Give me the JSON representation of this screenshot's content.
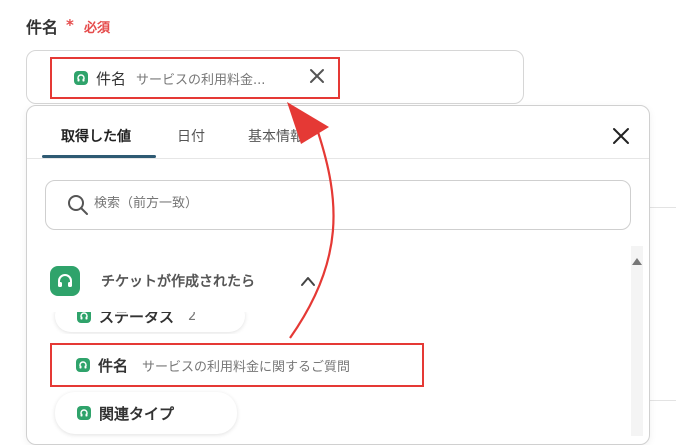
{
  "field": {
    "label": "件名",
    "required_star": "*",
    "required_text": "必須",
    "chip": {
      "title": "件名",
      "value": "サービスの利用料金..."
    }
  },
  "panel": {
    "tabs": [
      {
        "label": "取得した値",
        "active": true
      },
      {
        "label": "日付",
        "active": false
      },
      {
        "label": "基本情報",
        "active": false
      }
    ],
    "search": {
      "placeholder": "検索（前方一致）"
    },
    "group": {
      "label": "チケットが作成されたら"
    },
    "items": [
      {
        "title": "ステータス",
        "value": "2"
      },
      {
        "title": "件名",
        "value": "サービスの利用料金に関するご質問"
      },
      {
        "title": "関連タイプ",
        "value": ""
      }
    ]
  },
  "icons": {
    "chip": "headset-icon",
    "chip_close": "close-icon",
    "panel_close": "close-icon",
    "search": "search-icon",
    "group": "headset-icon",
    "caret": "chevron-up-icon"
  },
  "colors": {
    "brand_green": "#2fa36b",
    "highlight_red": "#e53935",
    "required_red": "#e54b4b",
    "tab_underline": "#2e5a73"
  }
}
